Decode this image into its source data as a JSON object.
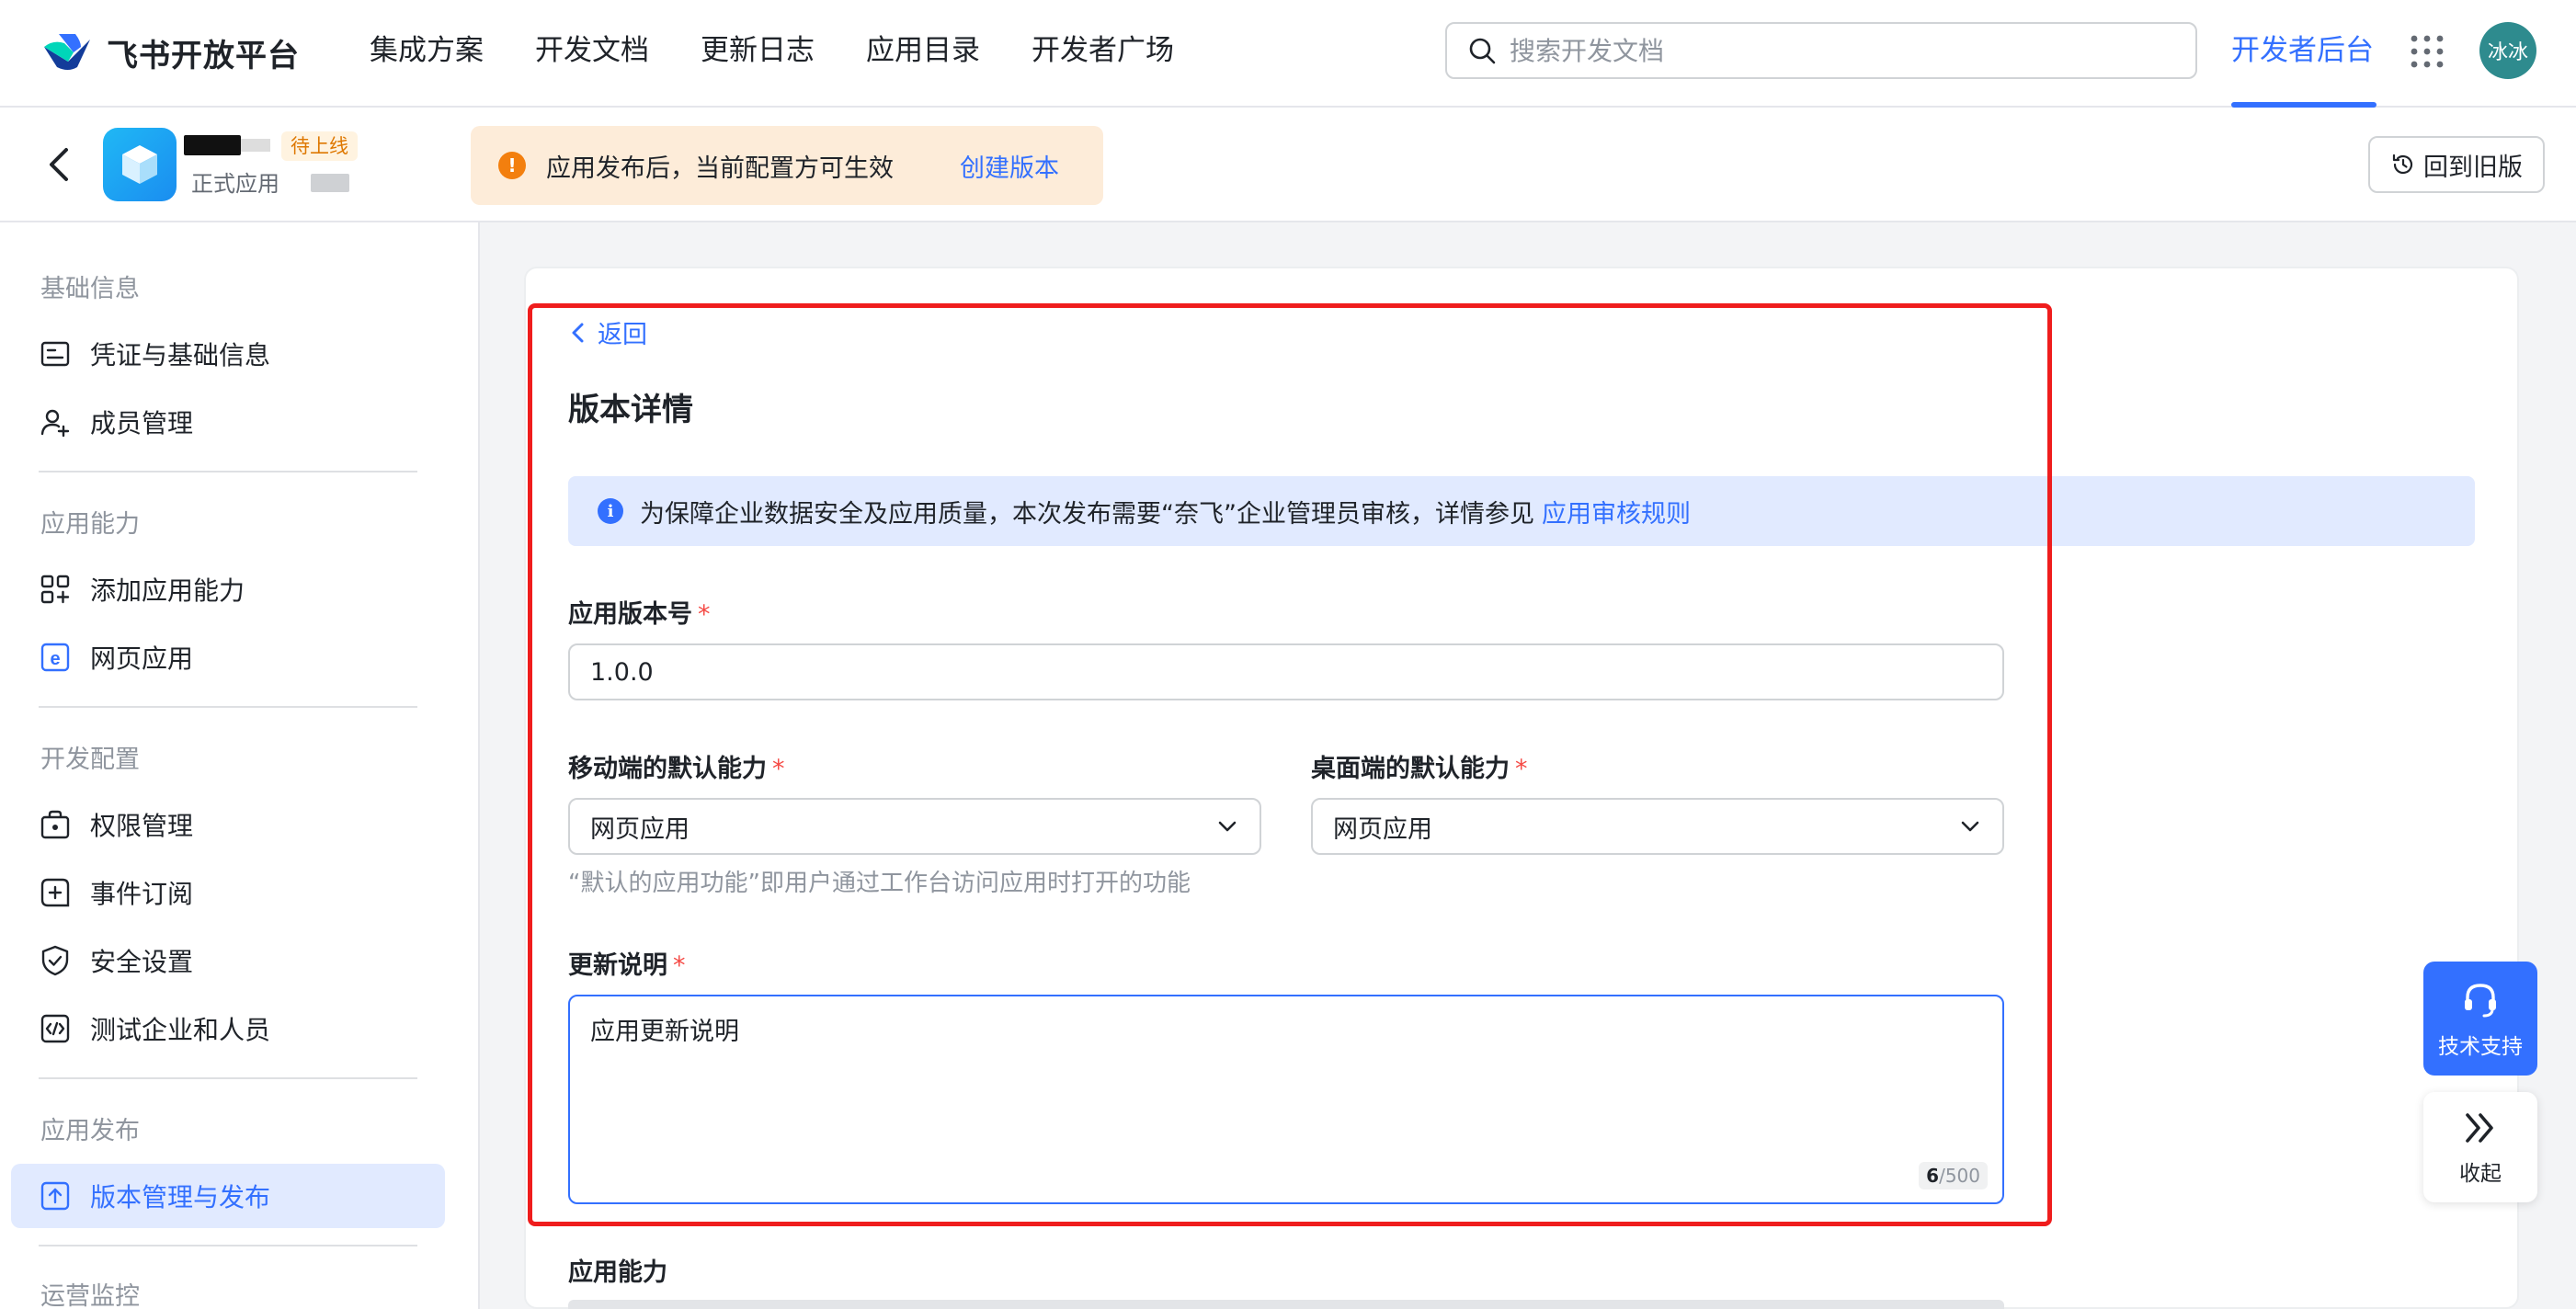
{
  "topnav": {
    "brand": "飞书开放平台",
    "links": [
      "集成方案",
      "开发文档",
      "更新日志",
      "应用目录",
      "开发者广场"
    ],
    "search_placeholder": "搜索开发文档",
    "dev_console": "开发者后台",
    "avatar_text": "冰冰"
  },
  "app_header": {
    "badge": "待上线",
    "subtitle": "正式应用",
    "notice_text": "应用发布后，当前配置方可生效",
    "notice_link": "创建版本",
    "old_version_button": "回到旧版"
  },
  "sidebar": {
    "sections": [
      {
        "title": "基础信息",
        "items": [
          {
            "label": "凭证与基础信息",
            "icon": "credential-icon"
          },
          {
            "label": "成员管理",
            "icon": "member-add-icon"
          }
        ]
      },
      {
        "title": "应用能力",
        "items": [
          {
            "label": "添加应用能力",
            "icon": "add-capability-icon"
          },
          {
            "label": "网页应用",
            "icon": "webapp-icon"
          }
        ]
      },
      {
        "title": "开发配置",
        "items": [
          {
            "label": "权限管理",
            "icon": "permission-icon"
          },
          {
            "label": "事件订阅",
            "icon": "event-icon"
          },
          {
            "label": "安全设置",
            "icon": "shield-icon"
          },
          {
            "label": "测试企业和人员",
            "icon": "code-icon"
          }
        ]
      },
      {
        "title": "应用发布",
        "items": [
          {
            "label": "版本管理与发布",
            "icon": "publish-icon",
            "active": true
          }
        ]
      },
      {
        "title": "运营监控",
        "items": []
      }
    ]
  },
  "main": {
    "back": "返回",
    "title": "版本详情",
    "info_text": "为保障企业数据安全及应用质量，本次发布需要“奈飞”企业管理员审核，详情参见",
    "info_link": "应用审核规则",
    "version_label": "应用版本号",
    "version_value": "1.0.0",
    "mobile_label": "移动端的默认能力",
    "mobile_value": "网页应用",
    "desktop_label": "桌面端的默认能力",
    "desktop_value": "网页应用",
    "hint": "“默认的应用功能”即用户通过工作台访问应用时打开的功能",
    "update_label": "更新说明",
    "update_value": "应用更新说明",
    "counter_current": "6",
    "counter_max": "/500",
    "capability_title": "应用能力",
    "required_mark": "*"
  },
  "widgets": {
    "support": "技术支持",
    "collapse": "收起"
  },
  "colors": {
    "accent": "#3370ff",
    "warning": "#f37f0e",
    "highlight_frame": "#ef1d1d"
  }
}
